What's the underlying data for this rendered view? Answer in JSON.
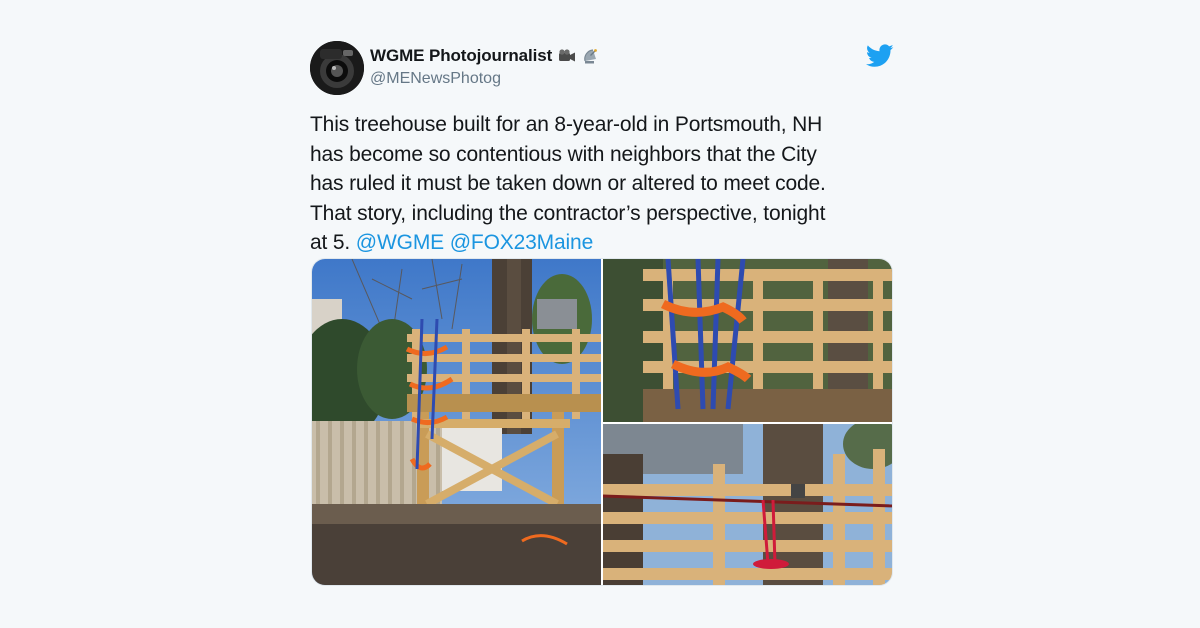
{
  "tweet": {
    "author": {
      "display_name": "WGME Photojournalist",
      "name_emojis": [
        "video-camera-icon",
        "satellite-dish-icon"
      ],
      "handle": "@MENewsPhotog"
    },
    "text_lines": [
      "This treehouse built for an 8-year-old in Portsmouth, NH",
      "has become so contentious with neighbors that the City",
      "has ruled it must be taken down or altered to meet code.",
      "That story, including the contractor’s perspective, tonight"
    ],
    "text_last_prefix": "at 5. ",
    "mentions": [
      "@WGME",
      "@FOX23Maine"
    ],
    "media": [
      {
        "icon": "treehouse-photo-wide"
      },
      {
        "icon": "treehouse-railing-closeup-photo"
      },
      {
        "icon": "treehouse-zipline-photo"
      }
    ]
  },
  "colors": {
    "background": "#f5f8fa",
    "text": "#14171a",
    "secondary": "#657786",
    "link": "#1b95e0",
    "twitter_blue": "#1da1f2"
  }
}
